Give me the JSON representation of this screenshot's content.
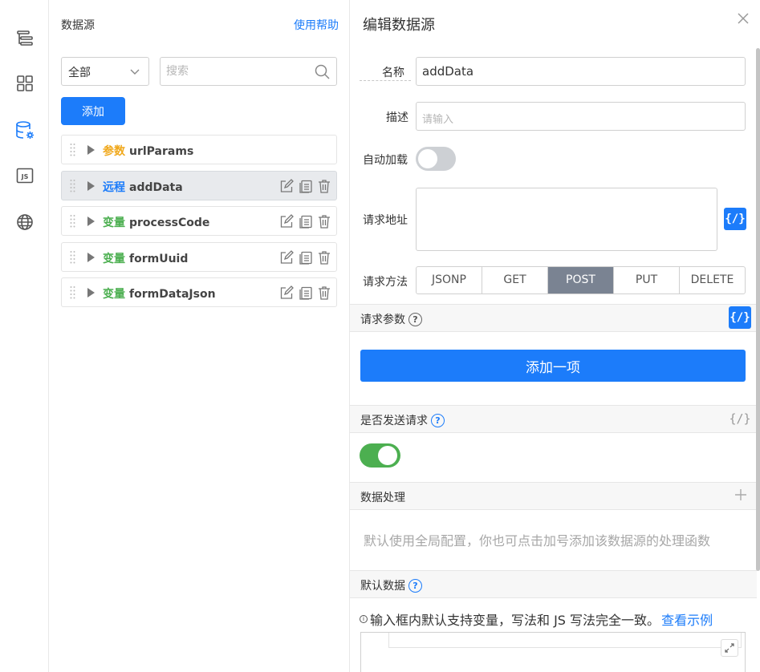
{
  "rail": {
    "icons": [
      "outline-icon",
      "components-icon",
      "datasource-icon",
      "js-icon",
      "globe-icon"
    ],
    "js_label": "JS",
    "accent": "#1c7cfa"
  },
  "datasource": {
    "title": "数据源",
    "help": "使用帮助",
    "filter_value": "全部",
    "search_placeholder": "搜索",
    "add_label": "添加",
    "items": [
      {
        "type": "参数",
        "name": "urlParams",
        "color": "#f0a81b",
        "active": false,
        "actions": false
      },
      {
        "type": "远程",
        "name": "addData",
        "color": "#1c7cfa",
        "active": true,
        "actions": true
      },
      {
        "type": "变量",
        "name": "processCode",
        "color": "#4caf50",
        "active": false,
        "actions": true
      },
      {
        "type": "变量",
        "name": "formUuid",
        "color": "#4caf50",
        "active": false,
        "actions": true
      },
      {
        "type": "变量",
        "name": "formDataJson",
        "color": "#4caf50",
        "active": false,
        "actions": true
      }
    ]
  },
  "editor": {
    "title": "编辑数据源",
    "name_label": "名称",
    "name_value": "addData",
    "desc_label": "描述",
    "desc_placeholder": "请输入",
    "autoload_label": "自动加载",
    "autoload_on": false,
    "url_label": "请求地址",
    "fx_label": "{/}",
    "method_label": "请求方法",
    "methods": [
      "JSONP",
      "GET",
      "POST",
      "PUT",
      "DELETE"
    ],
    "method_selected": "POST",
    "params_title": "请求参数",
    "add_item_label": "添加一项",
    "send_title": "是否发送请求",
    "send_on": true,
    "process_title": "数据处理",
    "process_hint": "默认使用全局配置，你也可点击加号添加该数据源的处理函数",
    "default_title": "默认数据",
    "default_note": "输入框内默认支持变量，写法和 JS 写法完全一致。",
    "default_link": "查看示例"
  }
}
